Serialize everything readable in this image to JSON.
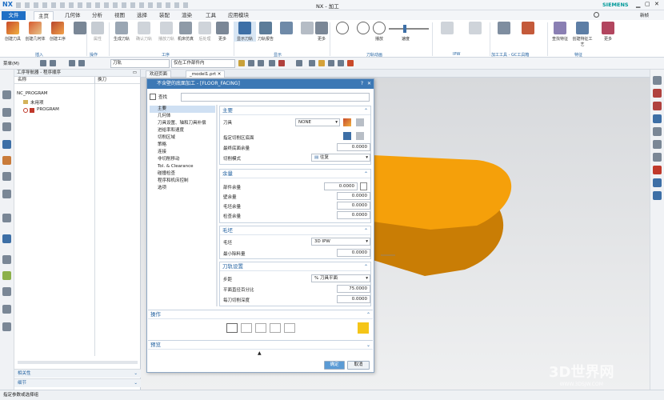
{
  "app": {
    "logo": "NX",
    "title": "NX - 加工",
    "brand": "SIEMENS"
  },
  "menu": {
    "tabs": [
      "文件(F)",
      "主页",
      "几何体",
      "分析",
      "视图",
      "选择",
      "装配",
      "渲染",
      "工具",
      "应用模块"
    ],
    "right": "新帧"
  },
  "ribbon": {
    "buttons": [
      "创建刀具",
      "创建几何体",
      "创建工序",
      "",
      "属性",
      "生成刀轨",
      "确认刀轨",
      "播放刀轨",
      "机床仿真",
      "后处理",
      "更多",
      "显示刀轨",
      "刀轨报告",
      "",
      "更多",
      "",
      "",
      "",
      "播放",
      "速度",
      "",
      "",
      "查找特征",
      "创建特征工艺",
      "更多"
    ],
    "groups": [
      "插入",
      "操作",
      "工序",
      "显示",
      "刀轨动画",
      "IPW",
      "加工工具 - GC工具箱",
      "特征"
    ]
  },
  "toolbar2": {
    "menu": "菜单(M)",
    "filter": "刀轨",
    "scope": "仅在工作部件内"
  },
  "navigator": {
    "title": "工序导航器 - 程序顺序",
    "col_name": "名称",
    "col_tool": "换刀",
    "items": [
      "NC_PROGRAM",
      "未用项",
      "PROGRAM"
    ],
    "folds": [
      "相关性",
      "细节"
    ]
  },
  "doc_tabs": [
    "欢迎页面",
    "_model1.prt"
  ],
  "dialog": {
    "title": "不含壁的底面加工 - [FLOOR_FACING]",
    "find_label": "查找",
    "categories": [
      "主要",
      "几何体",
      "刀具设置、轴和刀具补偿",
      "进给率和速度",
      "切削区域",
      "策略",
      "连接",
      "非切削移动",
      "Tol. & Clearance",
      "碰撞检查",
      "程序和机床控制",
      "选项"
    ],
    "sections": {
      "main": {
        "title": "主要",
        "tool_label": "刀具",
        "tool_value": "NONE",
        "area_label": "指定切削区底面",
        "floor_stock_label": "最终底面余量",
        "floor_stock": "0.0000",
        "pattern_label": "切削模式",
        "pattern": "往复"
      },
      "stock": {
        "title": "余量",
        "part_label": "部件余量",
        "part": "0.0000",
        "wall_label": "壁余量",
        "wall": "0.0000",
        "blank_label": "毛坯余量",
        "blank": "0.0000",
        "check_label": "检查余量",
        "check": "0.0000"
      },
      "blank": {
        "title": "毛坯",
        "blank_label": "毛坯",
        "blank_value": "3D IPW",
        "min_label": "最小除料量",
        "min": "0.0000"
      },
      "path": {
        "title": "刀轨设置",
        "step_label": "步距",
        "step_value": "% 刀具平面",
        "pct_label": "平面直径百分比",
        "pct": "75.0000",
        "depth_label": "每刀切削深度",
        "depth": "0.0000"
      },
      "ops": {
        "title": "操作"
      },
      "preview": {
        "title": "预览"
      }
    },
    "ok": "确定",
    "cancel": "取消"
  },
  "status": "指定参数或选择组",
  "watermark": "3D世界网",
  "watermark_url": "WWW.3DSJW.COM",
  "colors": {
    "accent": "#1f6fc5",
    "part": "#f5a00a"
  }
}
